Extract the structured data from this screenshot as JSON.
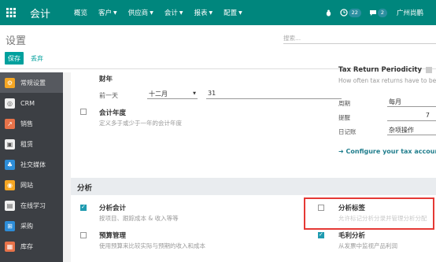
{
  "topbar": {
    "brand": "会计",
    "menu": [
      {
        "label": "概览",
        "caret": false
      },
      {
        "label": "客户",
        "caret": true
      },
      {
        "label": "供应商",
        "caret": true
      },
      {
        "label": "会计",
        "caret": true
      },
      {
        "label": "报表",
        "caret": true
      },
      {
        "label": "配置",
        "caret": true
      }
    ],
    "activity_count": "22",
    "message_count": "2",
    "company": "广州尚鹏"
  },
  "control_panel": {
    "title": "设置",
    "search_placeholder": "搜索...",
    "save_label": "保存",
    "discard_label": "丢弃"
  },
  "sidebar": {
    "items": [
      {
        "label": "常规设置",
        "icon": "gear-icon",
        "color": "#f5a623"
      },
      {
        "label": "CRM",
        "icon": "crm-icon",
        "color": "#f0f0f0"
      },
      {
        "label": "销售",
        "icon": "sales-chart-icon",
        "color": "#e8734a"
      },
      {
        "label": "租赁",
        "icon": "rental-icon",
        "color": "#f0f0f0"
      },
      {
        "label": "社交媒体",
        "icon": "social-media-icon",
        "color": "#2d8dd8"
      },
      {
        "label": "网站",
        "icon": "website-icon",
        "color": "#f5a623"
      },
      {
        "label": "在线学习",
        "icon": "elearning-icon",
        "color": "#f0f0f0"
      },
      {
        "label": "采购",
        "icon": "purchase-icon",
        "color": "#2d8dd8"
      },
      {
        "label": "库存",
        "icon": "inventory-icon",
        "color": "#e8734a"
      }
    ]
  },
  "fiscal": {
    "heading": "财年",
    "last_day_label": "前一天",
    "month_value": "十二月",
    "day_value": "31",
    "fiscal_years_label": "会计年度",
    "fiscal_years_desc": "定义多于或少于一年的会计年度"
  },
  "tax_return": {
    "heading": "Tax Return Periodicity",
    "desc": "How often tax returns have to be r",
    "periodicity_label": "周期",
    "periodicity_value": "每月",
    "reminder_label": "提醒",
    "reminder_value": "7",
    "journal_label": "日记账",
    "journal_value": "杂项操作",
    "configure_link": "Configure your tax accounts"
  },
  "analytics": {
    "section_title": "分析",
    "analytic_accounting_label": "分析会计",
    "analytic_accounting_desc": "按项目、跟踪成本 & 收入等等",
    "analytic_accounting_checked": true,
    "analytic_tags_label": "分析标签",
    "analytic_tags_desc": "允许标记分析分录并管理分析分配",
    "analytic_tags_checked": false,
    "budget_label": "预算管理",
    "budget_desc": "使用预算来比较实际与预期的收入和成本",
    "budget_checked": false,
    "margin_label": "毛利分析",
    "margin_desc": "从发票中监视产品利润",
    "margin_checked": true
  },
  "colors": {
    "topbar": "#00867d",
    "primary_button": "#00a09d",
    "checkbox_checked": "#1f9bb0",
    "highlight_box": "#e53935",
    "sidebar_bg": "#3c3f44"
  }
}
